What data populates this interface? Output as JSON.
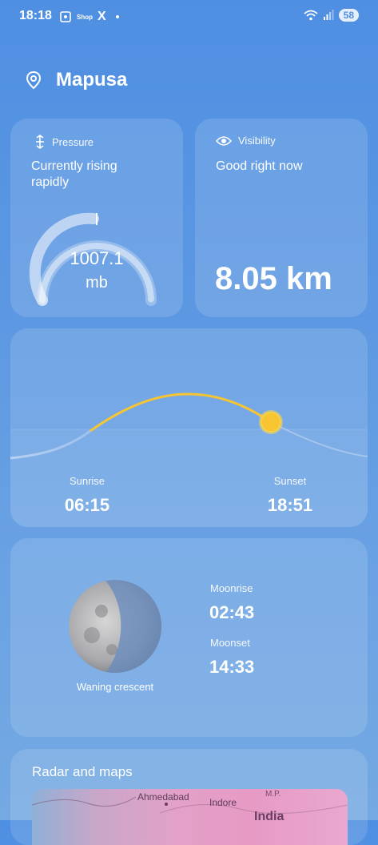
{
  "status_bar": {
    "time": "18:18",
    "shop_label": "Shop",
    "x_label": "X",
    "battery": "58",
    "icons": [
      "screenshot-icon",
      "shop-icon",
      "x-icon",
      "wifi-icon",
      "signal-icon",
      "battery-icon"
    ]
  },
  "location": {
    "city": "Mapusa",
    "icon": "location-pin-icon"
  },
  "pressure": {
    "label": "Pressure",
    "status": "Currently rising rapidly",
    "value": "1007.1",
    "unit": "mb",
    "icon": "pressure-icon"
  },
  "visibility": {
    "label": "Visibility",
    "status": "Good right now",
    "value": "8.05 km",
    "icon": "eye-icon"
  },
  "sun": {
    "sunrise_label": "Sunrise",
    "sunrise_time": "06:15",
    "sunset_label": "Sunset",
    "sunset_time": "18:51",
    "sun_color": "#f7c531"
  },
  "moon": {
    "phase": "Waning crescent",
    "moonrise_label": "Moonrise",
    "moonrise_time": "02:43",
    "moonset_label": "Moonset",
    "moonset_time": "14:33"
  },
  "radar": {
    "title": "Radar and maps",
    "map_labels": [
      "Ahmedabad",
      "Indore",
      "M.P.",
      "India"
    ]
  }
}
